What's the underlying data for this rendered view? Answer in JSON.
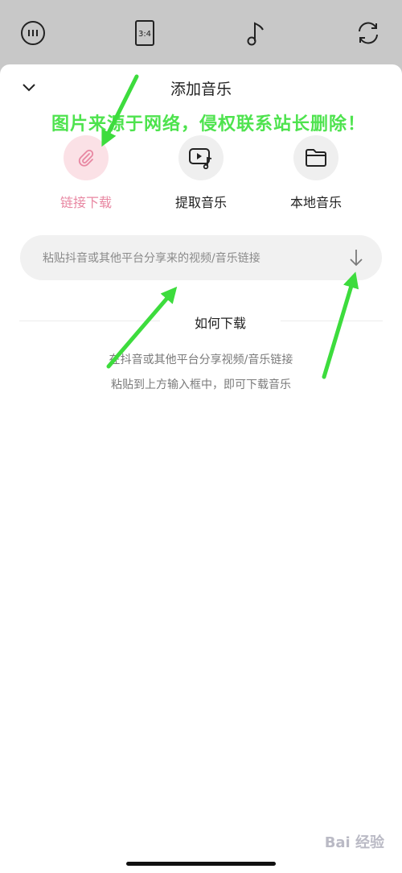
{
  "toolbar": {
    "icons": [
      "menu-circle-icon",
      "aspect-ratio-icon",
      "music-note-icon",
      "rotate-icon"
    ],
    "aspect_label": "3:4"
  },
  "sheet": {
    "title": "添加音乐",
    "collapse_icon": "chevron-down-icon"
  },
  "watermark": {
    "top_text": "图片来源于网络，侵权联系站长删除！",
    "bottom_text": "Bai 经验"
  },
  "options": [
    {
      "label": "链接下载",
      "icon": "link-paperclip-icon",
      "active": true
    },
    {
      "label": "提取音乐",
      "icon": "video-music-icon",
      "active": false
    },
    {
      "label": "本地音乐",
      "icon": "folder-icon",
      "active": false
    }
  ],
  "link_input": {
    "placeholder": "粘贴抖音或其他平台分享来的视频/音乐链接",
    "value": "",
    "button_icon": "download-arrow-icon"
  },
  "howto": {
    "title": "如何下载",
    "line1": "在抖音或其他平台分享视频/音乐链接",
    "line2": "粘贴到上方输入框中，即可下载音乐"
  },
  "colors": {
    "accent_pink": "#e887a2",
    "accent_pink_bg": "#fbe1e6",
    "annotation_green": "#3ddc3d",
    "topbar_gray": "#c8c8c8"
  }
}
